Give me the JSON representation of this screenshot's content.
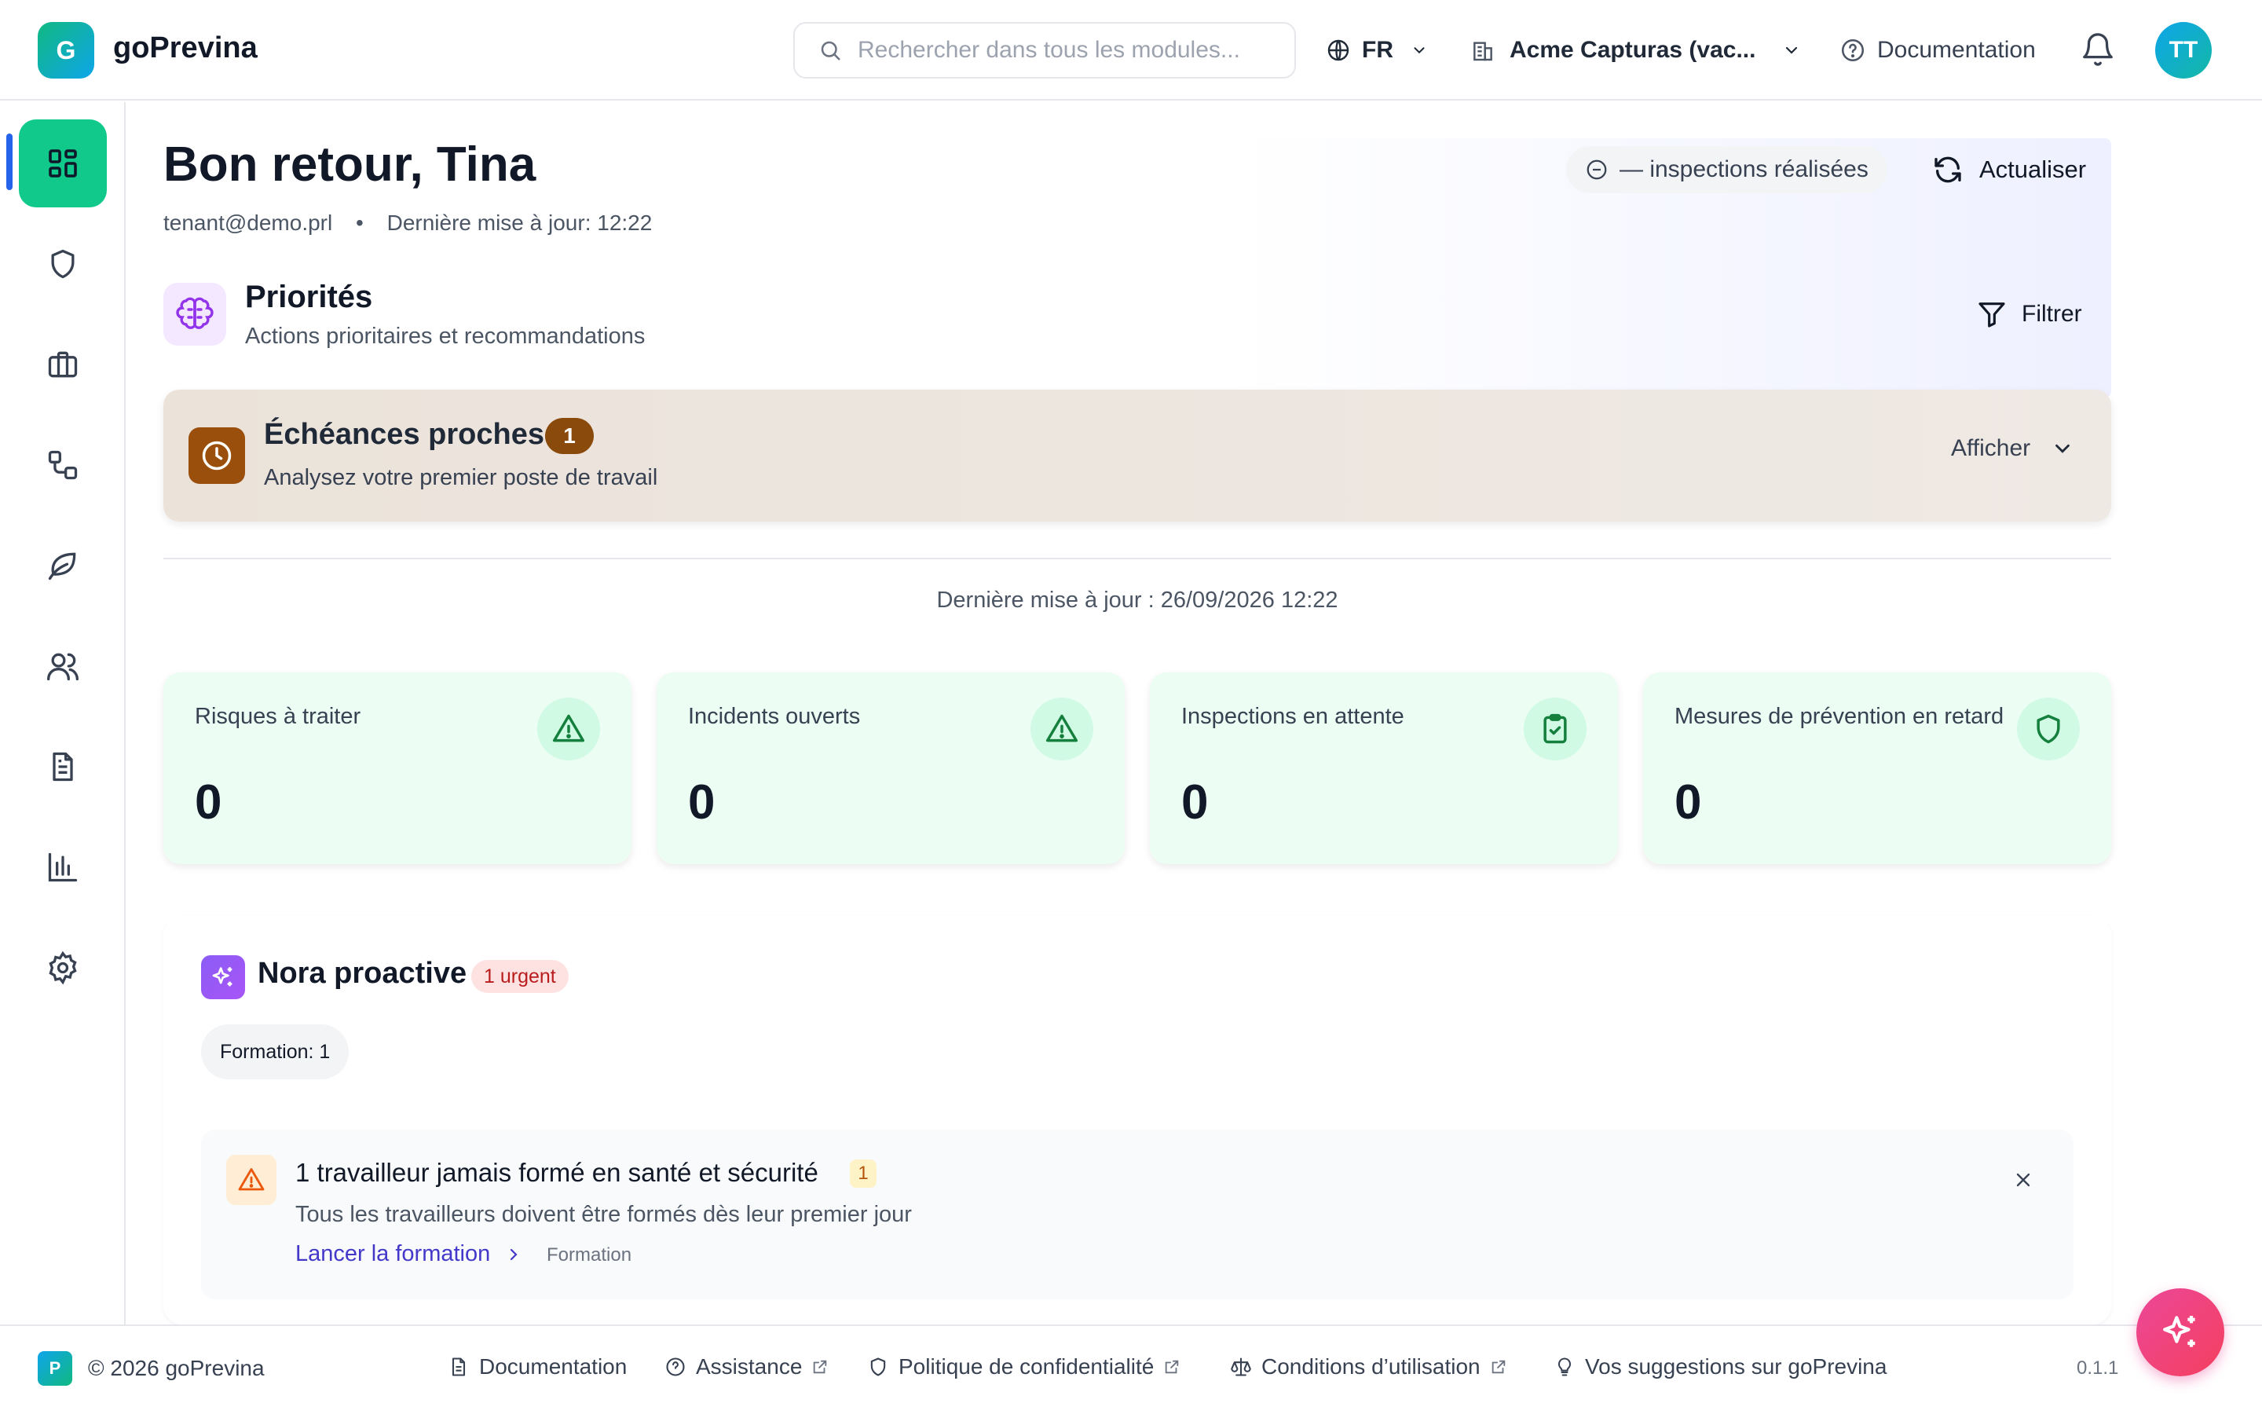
{
  "header": {
    "logo_letter": "G",
    "brand": "goPrevina",
    "search_placeholder": "Rechercher dans tous les modules...",
    "language": "FR",
    "organization": "Acme Capturas (vac...",
    "documentation": "Documentation",
    "avatar_initials": "TT"
  },
  "sidebar": {
    "items": [
      {
        "icon": "dashboard-icon",
        "active": true
      },
      {
        "icon": "shield-icon"
      },
      {
        "icon": "briefcase-icon"
      },
      {
        "icon": "workflow-icon"
      },
      {
        "icon": "leaf-icon"
      },
      {
        "icon": "users-icon"
      },
      {
        "icon": "document-icon"
      },
      {
        "icon": "bar-chart-icon"
      },
      {
        "icon": "gear-icon"
      }
    ]
  },
  "hero": {
    "greeting": "Bon retour, Tina",
    "email": "tenant@demo.prl",
    "separator": "•",
    "last_update": "Dernière mise à jour: 12:22",
    "inspections_pill": "— inspections réalisées",
    "refresh_label": "Actualiser"
  },
  "priorities": {
    "title": "Priorités",
    "subtitle": "Actions prioritaires et recommandations",
    "filter_label": "Filtrer"
  },
  "deadlines": {
    "title": "Échéances proches",
    "count": "1",
    "subtitle": "Analysez votre premier poste de travail",
    "show_label": "Afficher"
  },
  "updated_line": "Dernière mise à jour : 26/09/2026 12:22",
  "stats": [
    {
      "label": "Risques à traiter",
      "value": "0",
      "icon": "warning-triangle-icon"
    },
    {
      "label": "Incidents ouverts",
      "value": "0",
      "icon": "warning-triangle-icon"
    },
    {
      "label": "Inspections en attente",
      "value": "0",
      "icon": "clipboard-check-icon"
    },
    {
      "label": "Mesures de prévention en retard",
      "value": "0",
      "icon": "shield-icon"
    }
  ],
  "nora": {
    "title": "Nora proactive",
    "urgent_badge": "1 urgent",
    "chip": "Formation: 1",
    "alert": {
      "title": "1 travailleur jamais formé en santé et sécurité",
      "count": "1",
      "description": "Tous les travailleurs doivent être formés dès leur premier jour",
      "action": "Lancer la formation",
      "tag": "Formation"
    }
  },
  "footer": {
    "logo_letter": "P",
    "copyright": "© 2026 goPrevina",
    "links": [
      "Documentation",
      "Assistance",
      "Politique de confidentialité",
      "Conditions d’utilisation",
      "Vos suggestions sur goPrevina"
    ],
    "version": "0.1.1"
  },
  "colors": {
    "accent_green": "#10c98a",
    "indicator_blue": "#2563eb",
    "deadline_brown": "#9a4f0c",
    "stat_bg": "#ecfdf3",
    "link_indigo": "#4338ca",
    "fab_pink": "#ec4899"
  }
}
